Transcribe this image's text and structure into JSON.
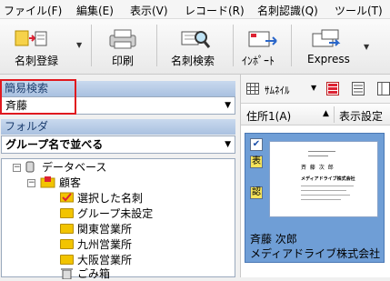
{
  "menu": [
    "ファイル(F)",
    "編集(E)",
    "表示(V)",
    "レコード(R)",
    "名刺認識(Q)",
    "ツール(T)"
  ],
  "toolbar": {
    "register": "名刺登録",
    "print": "印刷",
    "search": "名刺検索",
    "import": "ｲﾝﾎﾟｰﾄ",
    "express": "Express"
  },
  "quick_search": {
    "title": "簡易検索",
    "value": "斉藤"
  },
  "folder": {
    "title": "フォルダ",
    "sort": "グループ名で並べる"
  },
  "tree": {
    "root": "データベース",
    "customers": "顧客",
    "items": [
      "選択した名刺",
      "グループ未設定",
      "関東営業所",
      "九州営業所",
      "大阪営業所",
      "ごみ箱"
    ]
  },
  "view": {
    "thumbnail": "ｻﾑﾈｲﾙ"
  },
  "columns": {
    "sort_col": "住所1(A)",
    "display_settings": "表示設定"
  },
  "card": {
    "tag_front": "表",
    "tag_recognized": "認",
    "name": "斉藤 次郎",
    "company": "メディアドライブ株式会社",
    "image_company": "メディアドライブ株式会社",
    "image_name": "斉 藤 次 郎"
  },
  "colors": {
    "accent": "#1a3c6e",
    "card_bg": "#6f9ed6",
    "highlight_box": "#e0191f"
  }
}
